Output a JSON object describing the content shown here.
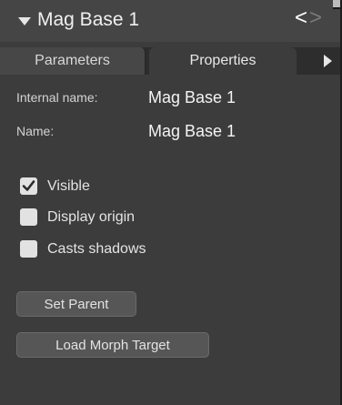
{
  "header": {
    "title": "Mag Base 1",
    "prev_glyph": "<",
    "next_glyph": ">",
    "collapse_icon": "triangle-down-icon",
    "menu_icon": "panel-menu-icon"
  },
  "tabs": [
    {
      "label": "Parameters",
      "active": false
    },
    {
      "label": "Properties",
      "active": true
    }
  ],
  "tabs_scroll_icon": "triangle-right-icon",
  "properties": {
    "internal_name_label": "Internal name:",
    "internal_name_value": "Mag Base 1",
    "name_label": "Name:",
    "name_value": "Mag Base 1"
  },
  "checkboxes": [
    {
      "label": "Visible",
      "checked": true
    },
    {
      "label": "Display origin",
      "checked": false
    },
    {
      "label": "Casts shadows",
      "checked": false
    }
  ],
  "buttons": {
    "set_parent": "Set Parent",
    "load_morph_target": "Load Morph Target"
  },
  "colors": {
    "panel_bg": "#3c3c3c",
    "header_bg": "#454545",
    "checkbox_fill": "#e2e2e2",
    "checkmark": "#2a2a2a"
  }
}
